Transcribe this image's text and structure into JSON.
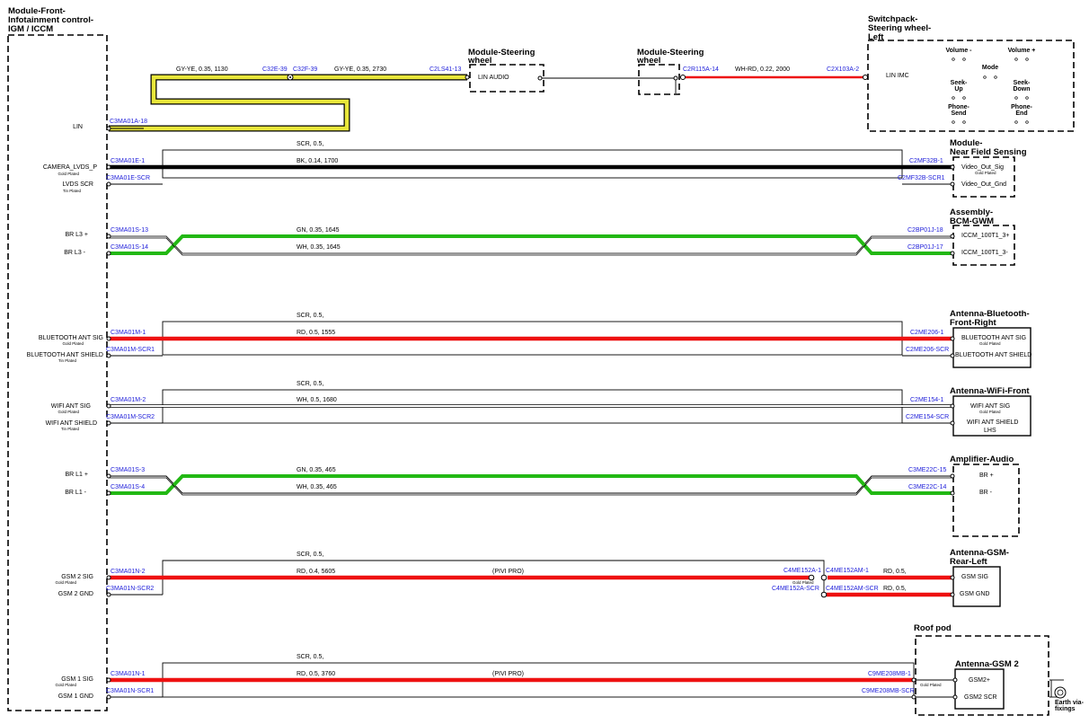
{
  "modules": {
    "iccm": {
      "title": [
        "Module-Front-",
        "Infotainment control-",
        "IGM / ICCM"
      ]
    },
    "steer1": {
      "title": [
        "Module-Steering",
        "wheel"
      ],
      "pin": "LIN AUDIO"
    },
    "steer2": {
      "title": [
        "Module-Steering",
        "wheel"
      ]
    },
    "switchpack": {
      "title": [
        "Switchpack-",
        "Steering wheel-",
        "Left"
      ],
      "pin": "LIN IMC",
      "buttons": {
        "vol_minus": "Volume -",
        "vol_plus": "Volume +",
        "mode": "Mode",
        "seek_up": [
          "Seek-",
          "Up"
        ],
        "seek_down": [
          "Seek-",
          "Down"
        ],
        "phone_send": [
          "Phone-",
          "Send"
        ],
        "phone_end": [
          "Phone-",
          "End"
        ]
      }
    },
    "nfs": {
      "title": [
        "Module-",
        "Near Field Sensing"
      ],
      "pins": [
        "Video_Out_Sig",
        "Gold Plated",
        "Video_Out_Gnd"
      ]
    },
    "bcm": {
      "title": [
        "Assembly-",
        "BCM-GWM"
      ],
      "pins": [
        "ICCM_100T1_3+",
        "ICCM_100T1_3-"
      ]
    },
    "bt": {
      "title": [
        "Antenna-Bluetooth-",
        "Front-Right"
      ],
      "pins": [
        "BLUETOOTH ANT SIG",
        "Gold Plated",
        "BLUETOOTH ANT SHIELD"
      ]
    },
    "wifi": {
      "title": [
        "Antenna-WiFi-Front"
      ],
      "pins": [
        "WIFI ANT SIG",
        "Gold Plated",
        "WIFI ANT SHIELD",
        "LHS"
      ]
    },
    "amp": {
      "title": [
        "Amplifier-Audio"
      ],
      "pins": [
        "BR +",
        "BR -"
      ]
    },
    "gsm_rl": {
      "title": [
        "Antenna-GSM-",
        "Rear-Left"
      ],
      "pins": [
        "GSM SIG",
        "GSM GND"
      ]
    },
    "roofpod": {
      "title": [
        "Roof pod"
      ]
    },
    "gsm2": {
      "title": [
        "Antenna-GSM 2"
      ],
      "pins": [
        "GSM2+",
        "GSM2 SCR"
      ],
      "plating": "Gold Plated"
    },
    "earth": {
      "label": [
        "Earth via-",
        "fixings"
      ]
    }
  },
  "left_pins": {
    "lin": "LIN",
    "camera": "CAMERA_LVDS_P",
    "gold1": "Gold Plated",
    "lvds_scr": "LVDS SCR",
    "tin1": "Tin Plated",
    "brl3p": "BR L3 +",
    "brl3m": "BR L3 -",
    "bt_sig": "BLUETOOTH ANT SIG",
    "gold2": "Gold Plated",
    "bt_shield": "BLUETOOTH ANT SHIELD",
    "tin2": "Tin Plated",
    "wifi_sig": "WIFI ANT SIG",
    "gold3": "Gold Plated",
    "wifi_shield": "WIFI ANT SHIELD",
    "tin3": "Tin Plated",
    "brl1p": "BR L1 +",
    "brl1m": "BR L1 -",
    "gsm2_sig": "GSM 2 SIG",
    "gold4": "Gold Plated",
    "gsm2_gnd": "GSM 2 GND",
    "gsm1_sig": "GSM 1 SIG",
    "gold5": "Gold Plated",
    "gsm1_gnd": "GSM 1 GND"
  },
  "connectors": {
    "c3ma01a18": "C3MA01A-18",
    "c32e39": "C32E-39",
    "c32f39": "C32F-39",
    "c2ls41_13": "C2LS41-13",
    "c2r115a14": "C2R115A-14",
    "c2x103a2": "C2X103A-2",
    "c3ma01e1": "C3MA01E-1",
    "c3ma01escr": "C3MA01E-SCR",
    "c2mf32b1": "C2MF32B-1",
    "c2mf32bscr": "C2MF32B-SCR1",
    "c3ma01s13": "C3MA01S-13",
    "c3ma01s14": "C3MA01S-14",
    "c2bp01j18": "C2BP01J-18",
    "c2bp01j17": "C2BP01J-17",
    "c3ma01m1": "C3MA01M-1",
    "c3ma01mscr": "C3MA01M-SCR1",
    "c2me206_1": "C2ME206-1",
    "c2me206scr": "C2ME206-SCR",
    "c3ma01m2": "C3MA01M-2",
    "c3ma01mscr2": "C3MA01M-SCR2",
    "c2me154_1": "C2ME154-1",
    "c2me154scr": "C2ME154-SCR",
    "c3ma01s3": "C3MA01S-3",
    "c3ma01s4": "C3MA01S-4",
    "c3me22c15": "C3ME22C-15",
    "c3me22c14": "C3ME22C-14",
    "c3ma01n2": "C3MA01N-2",
    "c3ma01nscr2": "C3MA01N-SCR2",
    "c4me152a1": "C4ME152A-1",
    "c4me152am1": "C4ME152AM-1",
    "c4me152ascr": "C4ME152A-SCR",
    "c4me152amscr": "C4ME152AM-SCR",
    "c3ma01n1": "C3MA01N-1",
    "c3ma01nscr1": "C3MA01N-SCR1",
    "c9me208mb1": "C9ME208MB-1",
    "c9me208mbscr": "C9ME208MB-SCR"
  },
  "wires": {
    "gy1": "GY-YE,  0.35,  1130",
    "gy2": "GY-YE,  0.35,  2730",
    "whrd": "WH-RD,  0.22,  2000",
    "scr": "SCR,  0.5,",
    "bk": "BK,  0.14,  1700",
    "gn1645": "GN,  0.35,  1645",
    "wh1645": "WH,  0.35,  1645",
    "rd1555": "RD,  0.5,  1555",
    "wh1680": "WH,  0.5,  1680",
    "gn465": "GN,  0.35,  465",
    "wh465": "WH,  0.35,  465",
    "rd5605": "RD,  0.4,  5605",
    "pivi": "(PIVI PRO)",
    "rd05": "RD,  0.5,",
    "rd3760": "RD,  0.5,  3760"
  },
  "colors": {
    "red": "#ee1111",
    "green": "#22b814",
    "yellow": "#e8e63a",
    "black": "#000000",
    "connector": "#1c1cd9"
  }
}
